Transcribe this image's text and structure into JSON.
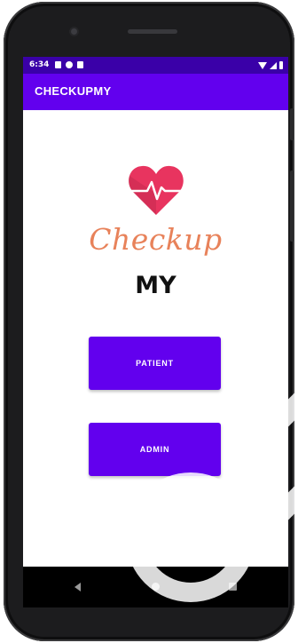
{
  "status_bar": {
    "time": "6:34",
    "icons": [
      "notification-icon",
      "notification-icon",
      "sd-card-icon",
      "wifi-icon",
      "signal-icon",
      "battery-icon"
    ]
  },
  "app_bar": {
    "title": "CHECKUPMY"
  },
  "logo": {
    "icon": "heart-pulse-icon",
    "script_text": "Checkup",
    "sub_text": "MY"
  },
  "buttons": {
    "patient_label": "PATIENT",
    "admin_label": "ADMIN"
  },
  "nav_bar": {
    "icons": [
      "back-icon",
      "home-icon",
      "recents-icon"
    ]
  },
  "colors": {
    "primary": "#6200ee",
    "status_bar": "#3a00a8",
    "logo_script": "#e8825a",
    "heart_main": "#e8345f",
    "heart_dark": "#c52a4f"
  }
}
